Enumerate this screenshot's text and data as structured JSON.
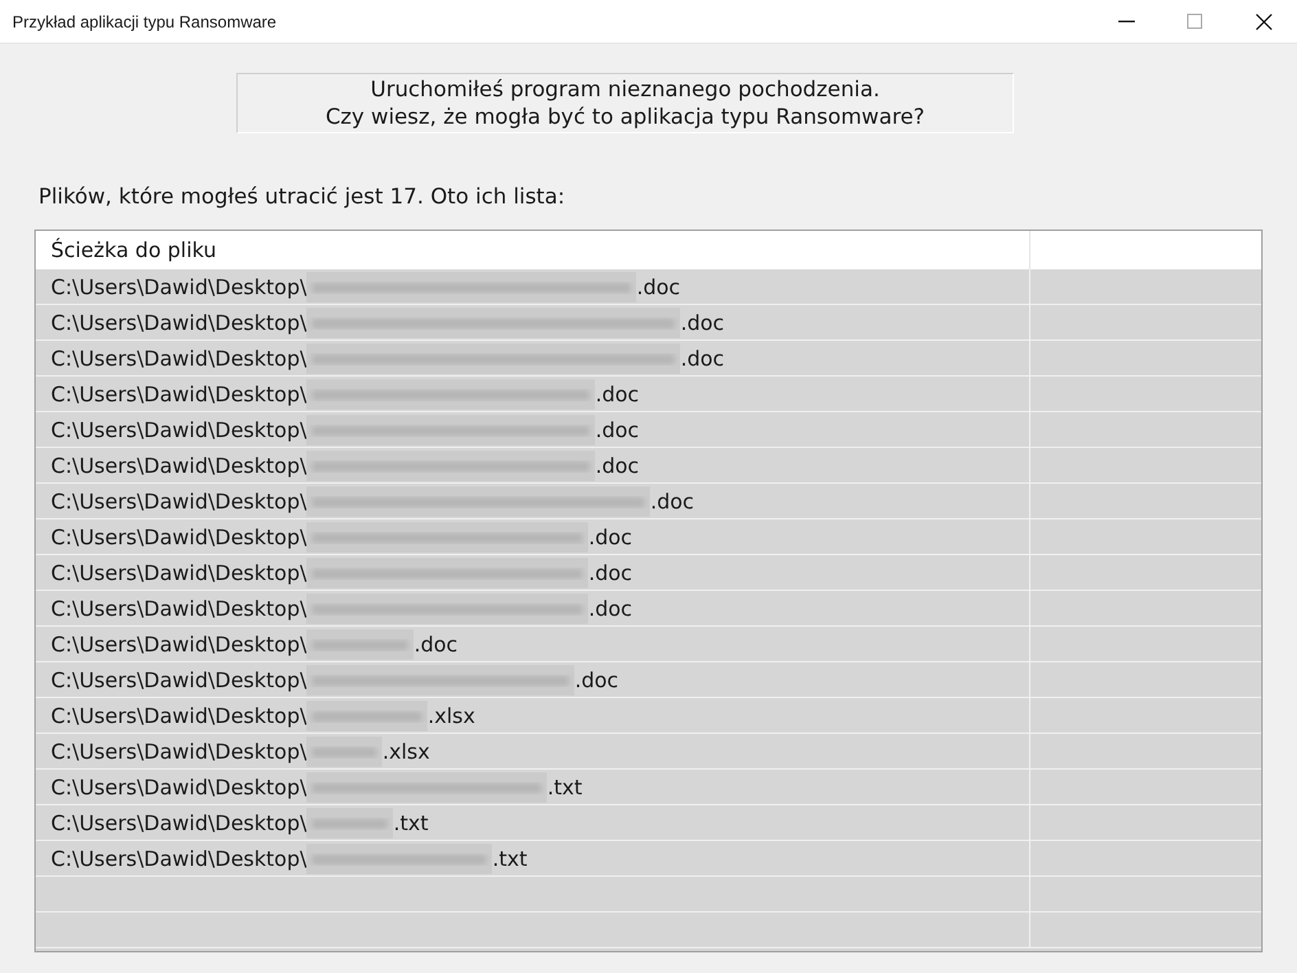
{
  "window": {
    "title": "Przykład aplikacji typu Ransomware"
  },
  "message": [
    "Uruchomiłeś program nieznanego pochodzenia.",
    "Czy wiesz, że mogła być to aplikacja typu Ransomware?"
  ],
  "summary": "Plików, które mogłeś utracić jest 17. Oto ich lista:",
  "table": {
    "columns": [
      "Ścieżka do pliku"
    ],
    "rows": [
      {
        "path": "C:\\Users\\Dawid\\Desktop\\",
        "ext": ".doc"
      },
      {
        "path": "C:\\Users\\Dawid\\Desktop\\",
        "ext": ".doc"
      },
      {
        "path": "C:\\Users\\Dawid\\Desktop\\",
        "ext": ".doc"
      },
      {
        "path": "C:\\Users\\Dawid\\Desktop\\",
        "ext": ".doc"
      },
      {
        "path": "C:\\Users\\Dawid\\Desktop\\",
        "ext": ".doc"
      },
      {
        "path": "C:\\Users\\Dawid\\Desktop\\",
        "ext": ".doc"
      },
      {
        "path": "C:\\Users\\Dawid\\Desktop\\",
        "ext": ".doc"
      },
      {
        "path": "C:\\Users\\Dawid\\Desktop\\",
        "ext": ".doc"
      },
      {
        "path": "C:\\Users\\Dawid\\Desktop\\",
        "ext": ".doc"
      },
      {
        "path": "C:\\Users\\Dawid\\Desktop\\",
        "ext": ".doc"
      },
      {
        "path": "C:\\Users\\Dawid\\Desktop\\",
        "ext": ".doc"
      },
      {
        "path": "C:\\Users\\Dawid\\Desktop\\",
        "ext": ".doc"
      },
      {
        "path": "C:\\Users\\Dawid\\Desktop\\",
        "ext": ".xlsx"
      },
      {
        "path": "C:\\Users\\Dawid\\Desktop\\",
        "ext": ".xlsx"
      },
      {
        "path": "C:\\Users\\Dawid\\Desktop\\",
        "ext": ".txt"
      },
      {
        "path": "C:\\Users\\Dawid\\Desktop\\",
        "ext": ".txt"
      },
      {
        "path": "C:\\Users\\Dawid\\Desktop\\",
        "ext": ".txt"
      }
    ]
  }
}
